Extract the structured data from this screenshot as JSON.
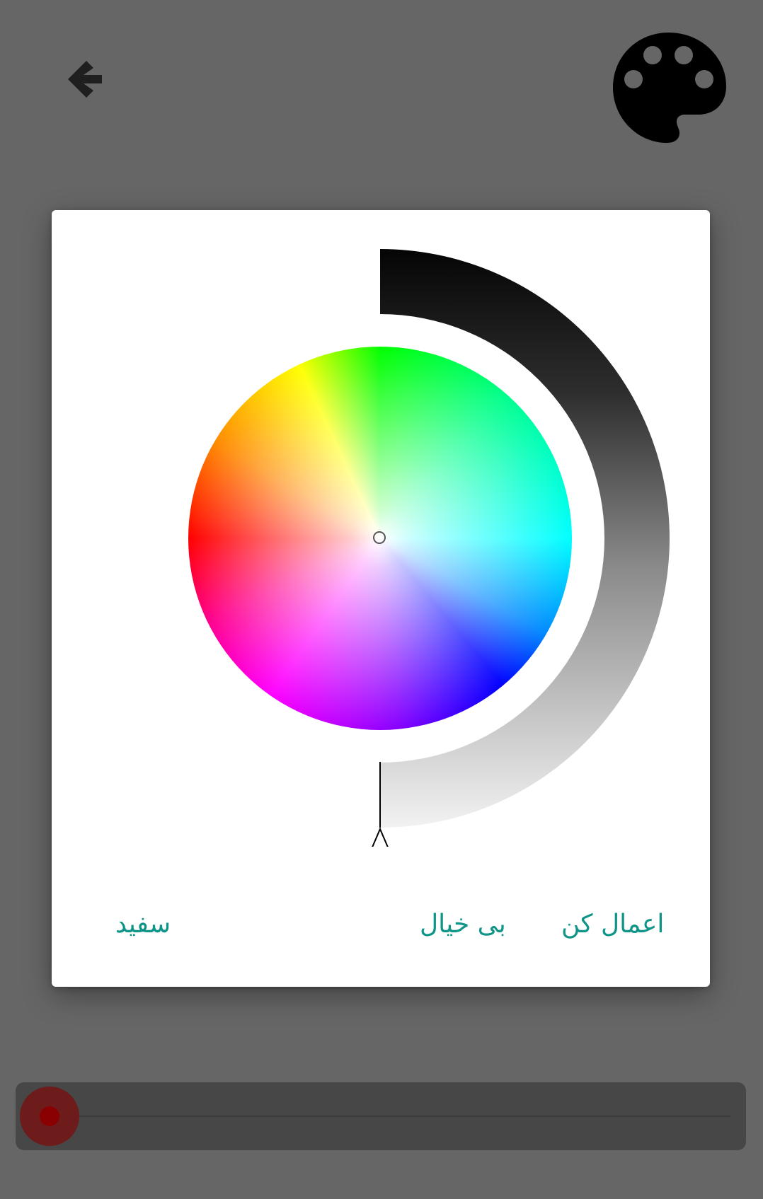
{
  "header": {
    "back_icon": "arrow-left-icon",
    "palette_icon": "palette-icon"
  },
  "dialog": {
    "buttons": {
      "apply_label": "اعمال کن",
      "dismiss_label": "بی خیال",
      "white_label": "سفید"
    },
    "brightness_slider_icon": "triangle-pointer-icon"
  },
  "bottom_bar": {
    "record_icon": "record-dot-icon"
  },
  "colors": {
    "accent": "#0f9488",
    "background": "#666666",
    "dialog": "#ffffff",
    "bar": "#474747",
    "record": "#8a0000"
  }
}
